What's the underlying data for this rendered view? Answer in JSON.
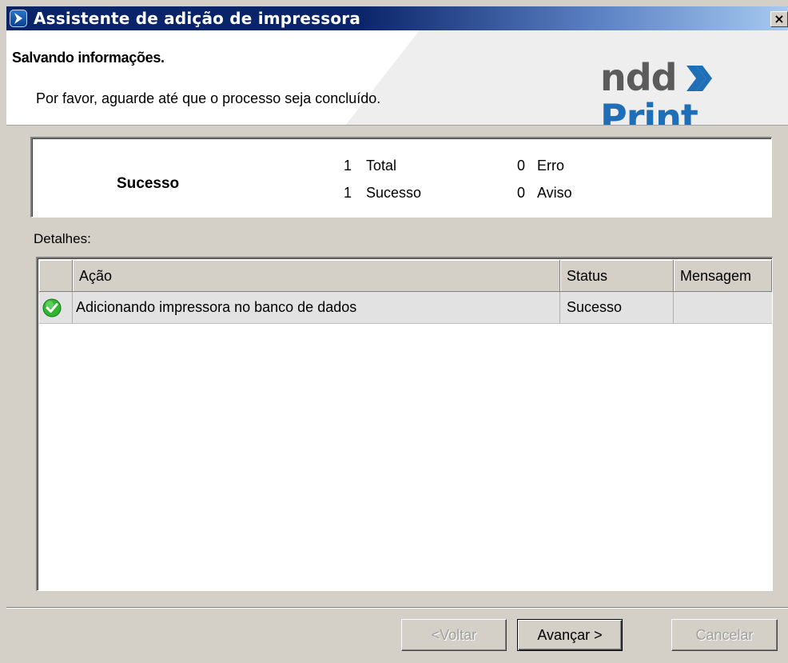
{
  "window": {
    "title": "Assistente de adição de impressora",
    "close_label": "×"
  },
  "header": {
    "title": "Salvando informações.",
    "subtitle": "Por favor, aguarde até que o processo seja concluído.",
    "brand_left": "ndd",
    "brand_right": "Print"
  },
  "summary": {
    "status": "Sucesso",
    "total_count": "1",
    "total_label": "Total",
    "success_count": "1",
    "success_label": "Sucesso",
    "error_count": "0",
    "error_label": "Erro",
    "warning_count": "0",
    "warning_label": "Aviso"
  },
  "details": {
    "label": "Detalhes:",
    "columns": [
      "Ação",
      "Status",
      "Mensagem"
    ],
    "rows": [
      {
        "action": "Adicionando impressora no banco de dados",
        "status": "Sucesso",
        "message": "",
        "icon": "check-icon"
      }
    ]
  },
  "buttons": {
    "back": "<Voltar",
    "next": "Avançar >",
    "cancel": "Cancelar"
  },
  "colors": {
    "titlebar": "#0a246a",
    "brand_gray": "#5b5b5b",
    "brand_blue": "#1f6fb8",
    "success_green": "#2fb52f"
  }
}
